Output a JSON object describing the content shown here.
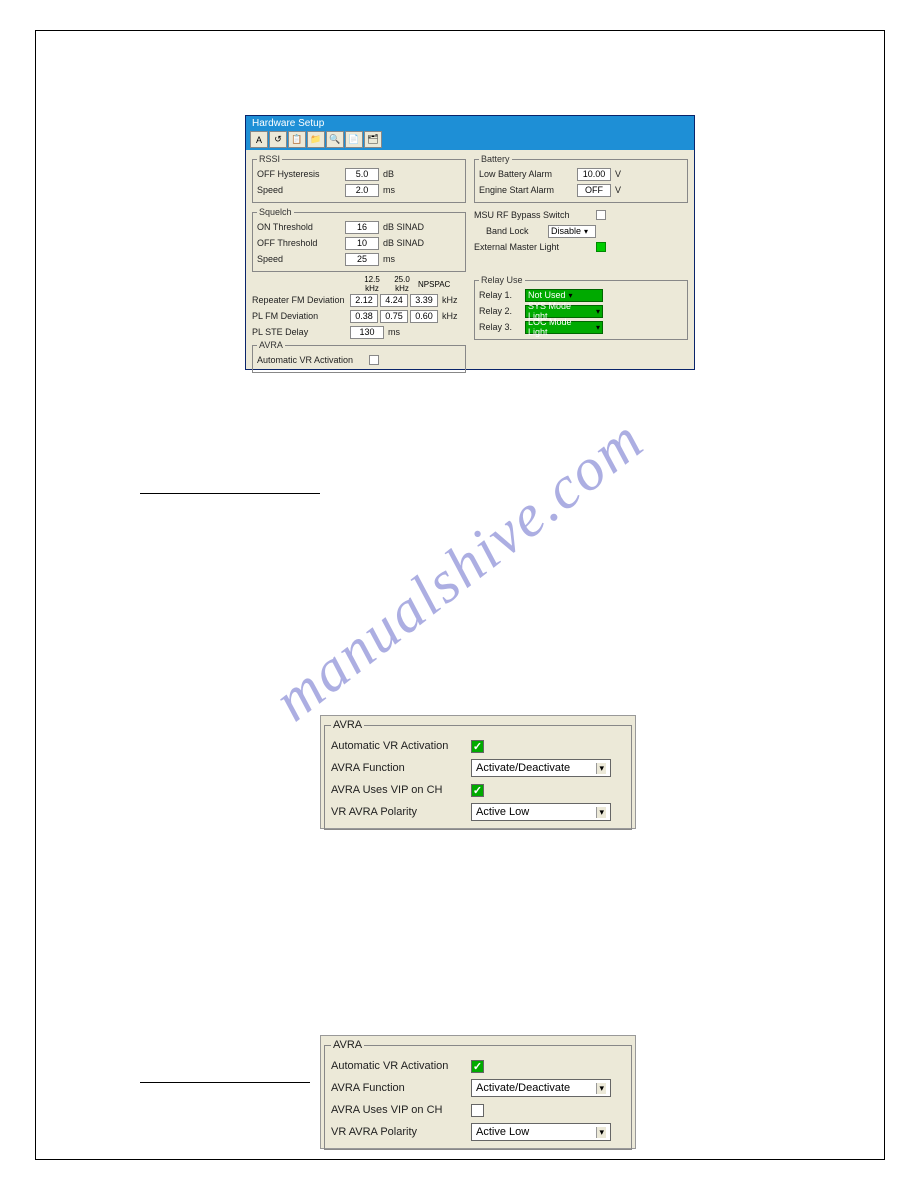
{
  "watermark": "manualshive.com",
  "hw": {
    "title": "Hardware Setup",
    "toolbar": [
      "A",
      "↺",
      "📋",
      "📁",
      "🔍",
      "📄",
      "🗂"
    ],
    "rssi": {
      "legend": "RSSI",
      "off_hyst_label": "OFF Hysteresis",
      "off_hyst_val": "5.0",
      "off_hyst_unit": "dB",
      "speed_label": "Speed",
      "speed_val": "2.0",
      "speed_unit": "ms"
    },
    "squelch": {
      "legend": "Squelch",
      "on_th_label": "ON Threshold",
      "on_th_val": "16",
      "on_th_unit": "dB SINAD",
      "off_th_label": "OFF Threshold",
      "off_th_val": "10",
      "off_th_unit": "dB SINAD",
      "speed_label": "Speed",
      "speed_val": "25",
      "speed_unit": "ms"
    },
    "dev": {
      "head1": "12.5 kHz",
      "head2": "25.0 kHz",
      "head3": "NPSPAC",
      "rep_label": "Repeater FM Deviation",
      "rep_v1": "2.12",
      "rep_v2": "4.24",
      "rep_v3": "3.39",
      "rep_unit": "kHz",
      "pl_label": "PL FM Deviation",
      "pl_v1": "0.38",
      "pl_v2": "0.75",
      "pl_v3": "0.60",
      "pl_unit": "kHz",
      "ste_label": "PL STE Delay",
      "ste_val": "130",
      "ste_unit": "ms"
    },
    "avra_small": {
      "legend": "AVRA",
      "auto_label": "Automatic VR Activation"
    },
    "battery": {
      "legend": "Battery",
      "low_label": "Low Battery Alarm",
      "low_val": "10.00",
      "low_unit": "V",
      "eng_label": "Engine Start Alarm",
      "eng_val": "OFF",
      "eng_unit": "V"
    },
    "msu": {
      "msu_label": "MSU RF Bypass Switch",
      "band_label": "Band Lock",
      "band_val": "Disable",
      "ext_label": "External Master Light"
    },
    "relay": {
      "legend": "Relay Use",
      "r1_label": "Relay 1.",
      "r1_val": "Not Used",
      "r2_label": "Relay 2.",
      "r2_val": "SYS Mode Light",
      "r3_label": "Relay 3.",
      "r3_val": "LOC Mode Light"
    }
  },
  "avra1": {
    "legend": "AVRA",
    "auto_label": "Automatic VR Activation",
    "auto_checked": true,
    "func_label": "AVRA Function",
    "func_val": "Activate/Deactivate",
    "vip_label": "AVRA Uses VIP on CH",
    "vip_checked": true,
    "pol_label": "VR AVRA Polarity",
    "pol_val": "Active Low"
  },
  "avra2": {
    "legend": "AVRA",
    "auto_label": "Automatic VR Activation",
    "auto_checked": true,
    "func_label": "AVRA Function",
    "func_val": "Activate/Deactivate",
    "vip_label": "AVRA Uses VIP on CH",
    "vip_checked": false,
    "pol_label": "VR AVRA Polarity",
    "pol_val": "Active Low"
  }
}
